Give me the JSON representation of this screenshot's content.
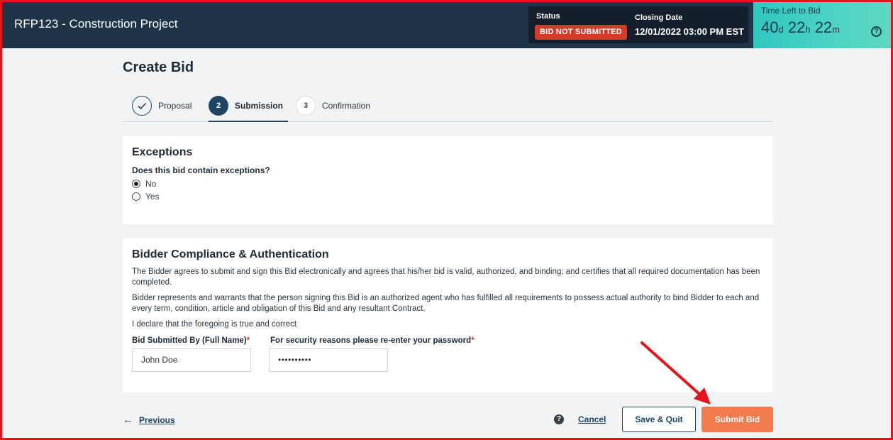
{
  "header": {
    "title": "RFP123 - Construction Project",
    "status_label": "Status",
    "status_value": "BID NOT SUBMITTED",
    "closing_label": "Closing Date",
    "closing_value": "12/01/2022 03:00 PM EST",
    "time_left_label": "Time Left to Bid",
    "time_left": {
      "days": "40",
      "days_unit": "d",
      "hours": "22",
      "hours_unit": "h",
      "minutes": "22",
      "minutes_unit": "m"
    },
    "help_icon": "?"
  },
  "page_title": "Create Bid",
  "stepper": {
    "steps": [
      {
        "number": "",
        "label": "Proposal",
        "state": "done"
      },
      {
        "number": "2",
        "label": "Submission",
        "state": "active"
      },
      {
        "number": "3",
        "label": "Confirmation",
        "state": "todo"
      }
    ]
  },
  "exceptions": {
    "title": "Exceptions",
    "question": "Does this bid contain exceptions?",
    "options": [
      {
        "label": "No",
        "selected": true
      },
      {
        "label": "Yes",
        "selected": false
      }
    ]
  },
  "compliance": {
    "title": "Bidder Compliance & Authentication",
    "paragraph1": "The Bidder agrees to submit and sign this Bid electronically and agrees that his/her bid is valid, authorized, and binding; and certifies that all required documentation has been completed.",
    "paragraph2": "Bidder represents and warrants that the person signing this Bid is an authorized agent who has fulfilled all requirements to possess actual authority to bind Bidder to each and every term, condition, article and obligation of this Bid and any resultant Contract.",
    "declaration": "I declare that the foregoing is true and correct",
    "name_label": "Bid Submitted By (Full Name)",
    "name_value": "John Doe",
    "password_label": "For security reasons please re-enter your password",
    "password_value": "••••••••••",
    "required_mark": "*"
  },
  "footer": {
    "previous_label": "Previous",
    "help_icon": "?",
    "cancel_label": "Cancel",
    "save_label": "Save & Quit",
    "submit_label": "Submit Bid"
  },
  "colors": {
    "header_bg": "#1f3448",
    "status_badge": "#d63b2a",
    "time_box": "#4fd4c4",
    "submit_button": "#f27a4f",
    "annotation_arrow": "#e3141b"
  }
}
